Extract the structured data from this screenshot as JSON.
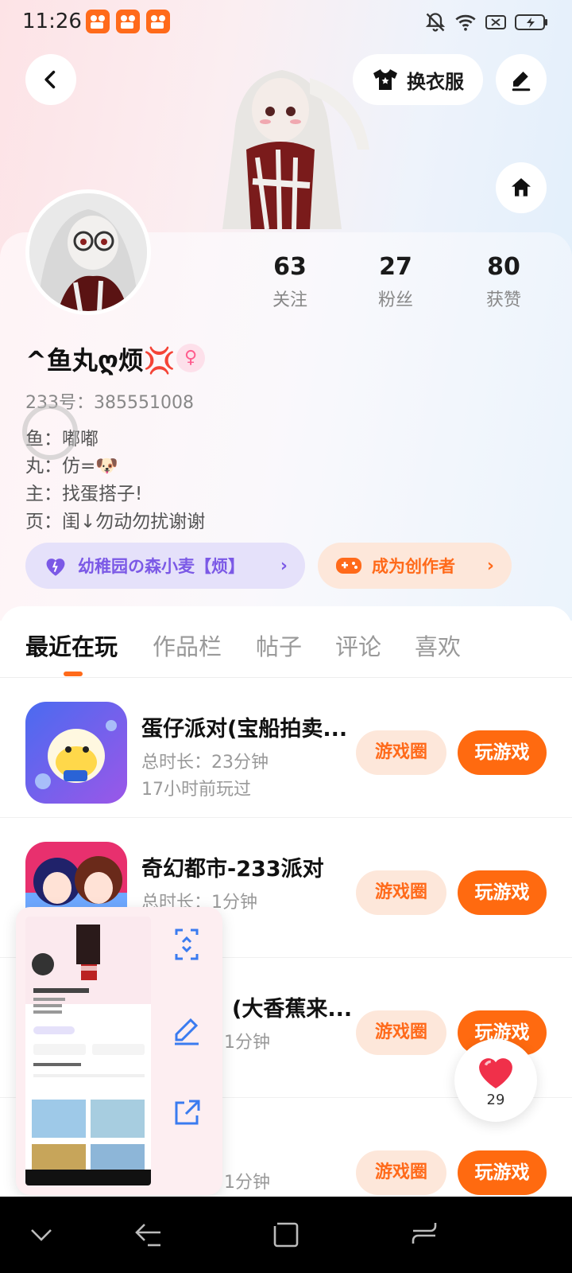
{
  "status_bar": {
    "time": "11:26",
    "app_badges": [
      "app-badge-icon",
      "app-badge-icon",
      "app-badge-icon"
    ],
    "icons": [
      "bell-off-icon",
      "wifi-icon",
      "sim-off-icon",
      "battery-charging-icon"
    ]
  },
  "header": {
    "outfit_label": "换衣服",
    "icons": [
      "back-arrow-icon",
      "tshirt-icon",
      "pencil-icon",
      "home-icon"
    ]
  },
  "profile": {
    "stats": [
      {
        "num": "63",
        "label": "关注"
      },
      {
        "num": "27",
        "label": "粉丝"
      },
      {
        "num": "80",
        "label": "获赞"
      }
    ],
    "nickname": "^鱼丸ღ烦💢",
    "gender_symbol": "♀",
    "uid": "233号：385551008",
    "bio": [
      "鱼：嘟嘟",
      "丸：仿=🐶",
      "主：找蛋搭子!",
      "页：闺↓勿动勿扰谢谢"
    ],
    "group_pill": "幼稚园の森小麦【烦】",
    "creator_pill": "成为创作者",
    "chevron": "›"
  },
  "tabs": [
    "最近在玩",
    "作品栏",
    "帖子",
    "评论",
    "喜欢"
  ],
  "games": [
    {
      "title": "蛋仔派对(宝船拍卖...",
      "duration": "总时长：23分钟",
      "last_played": "17小时前玩过",
      "circle_btn": "游戏圈",
      "play_btn": "玩游戏"
    },
    {
      "title": "奇幻都市-233派对",
      "duration": "总时长：1分钟",
      "last_played": "",
      "circle_btn": "游戏圈",
      "play_btn": "玩游戏"
    },
    {
      "title": "(大香蕉来...",
      "duration": "1分钟",
      "last_played": "",
      "circle_btn": "游戏圈",
      "play_btn": "玩游戏"
    },
    {
      "title": "",
      "duration": "1分钟",
      "last_played": "",
      "circle_btn": "游戏圈",
      "play_btn": "玩游戏"
    }
  ],
  "float_card": {
    "actions": [
      "scroll-capture-icon",
      "edit-icon",
      "share-icon"
    ]
  },
  "like_bubble": {
    "count": "29"
  },
  "nav": [
    "nav-down-icon",
    "nav-back-icon",
    "nav-home-icon",
    "nav-recent-icon"
  ],
  "colors": {
    "accent": "#ff6a10",
    "accent_light": "#fde7da",
    "purple": "#7b59e6",
    "purple_light": "#e5e1fa",
    "pink": "#ff5b8d"
  }
}
